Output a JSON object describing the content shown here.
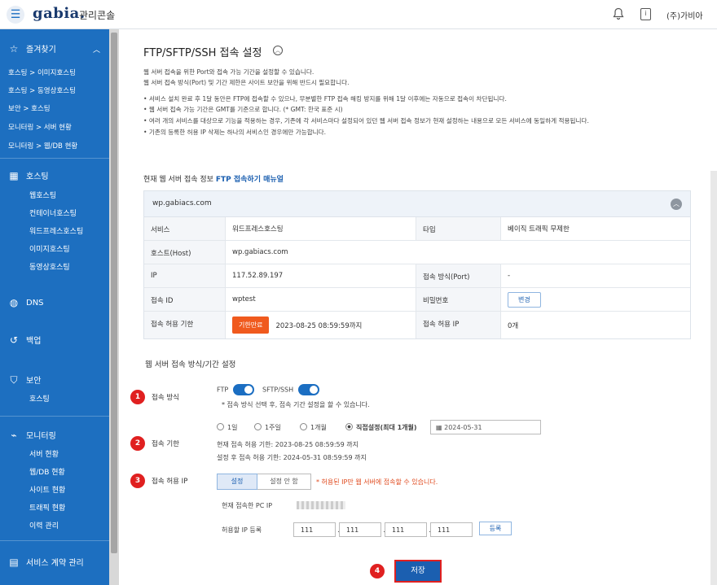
{
  "header": {
    "logo": "gabia.",
    "logo_sub": "관리콘솔",
    "user": "(주)가비아",
    "doc_icon_char": "i"
  },
  "sidebar": {
    "favorites": {
      "label": "즐겨찾기"
    },
    "fav_links": [
      "호스팅 > 이미지호스팅",
      "호스팅 > 동영상호스팅",
      "보안 > 호스팅",
      "모니터링 > 서버 현황",
      "모니터링 > 웹/DB 현황"
    ],
    "hosting": {
      "label": "호스팅",
      "items": [
        "웹호스팅",
        "컨테이너호스팅",
        "워드프레스호스팅",
        "이미지호스팅",
        "동영상호스팅"
      ]
    },
    "dns": {
      "label": "DNS"
    },
    "backup": {
      "label": "백업"
    },
    "security": {
      "label": "보안",
      "items": [
        "호스팅"
      ]
    },
    "monitoring": {
      "label": "모니터링",
      "items": [
        "서버 현황",
        "웹/DB 현황",
        "사이트 현황",
        "트래픽 현황",
        "이력 관리"
      ]
    },
    "contract": {
      "label": "서비스 계약 관리"
    }
  },
  "page": {
    "title": "FTP/SFTP/SSH 접속 설정",
    "desc": [
      "웹 서버 접속을 위한 Port와 접속 가능 기간을 설정할 수 있습니다.",
      "웹 서버 접속 방식(Port) 및 기간 제한은 사이트 보안을 위해 반드시 필요합니다."
    ],
    "bullets": [
      "• 서비스 설치 완료 후 1달 동안은 FTP에 접속할 수 있으나, 무분별한 FTP 접속 해킹 방지를 위해 1달 이후에는 자동으로 접속이 차단됩니다.",
      "• 웹 서버 접속 가능 기간은 GMT를 기준으로 합니다. (* GMT: 한국 표준 시)",
      "• 여러 개의 서비스를 대상으로 기능을 적용하는 경우, 기존에 각 서비스마다 설정되어 있던 웹 서버 접속 정보가 현재 설정하는 내용으로 모든 서비스에 동일하게 적용됩니다.",
      "• 기존의 등록한 허용 IP 삭제는 하나의 서비스인 경우에만 가능합니다."
    ]
  },
  "info": {
    "heading": "현재 웹 서버 접속 정보",
    "manual_link": "FTP 접속하기 매뉴얼",
    "domain": "wp.gabiacs.com",
    "service_label": "서비스",
    "service": "워드프레스호스팅",
    "type_label": "타입",
    "type": "베이직 트래픽 무제한",
    "host_label": "호스트(Host)",
    "host": "wp.gabiacs.com",
    "ip_label": "IP",
    "ip": "117.52.89.197",
    "port_label": "접속 방식(Port)",
    "port": "-",
    "id_label": "접속 ID",
    "id": "wptest",
    "pw_label": "비밀번호",
    "pw_btn": "변경",
    "period_label": "접속 허용 기한",
    "period_btn": "기한만료",
    "period": "2023-08-25 08:59:59까지",
    "allow_ip_label": "접속 허용 IP",
    "allow_ip": "0개"
  },
  "settings": {
    "heading": "웹 서버 접속 방식/기간 설정",
    "method": {
      "num": "1",
      "label": "접속 방식",
      "ftp": "FTP",
      "sftp": "SFTP/SSH",
      "note": "* 접속 방식 선택 후, 접속 기간 설정을 할 수 있습니다."
    },
    "period": {
      "num": "2",
      "label": "접속 기한",
      "options": [
        "1일",
        "1주일",
        "1개월",
        "직접설정(최대 1개월)"
      ],
      "date": "2024-05-31",
      "current": "현재 접속 허용 기한: 2023-08-25 08:59:59 까지",
      "after": "설정 후 접속 허용 기한: 2024-05-31 08:59:59 까지"
    },
    "ip": {
      "num": "3",
      "label": "접속 허용 IP",
      "set": "설정",
      "unset": "설정 안 함",
      "warn": "* 허용된 IP만 웹 서버에 접속할 수 있습니다.",
      "current_pc": "현재 접속한 PC IP",
      "reg_label": "허용할 IP 등록",
      "octets": [
        "111",
        "111",
        "111",
        "111"
      ],
      "reg_btn": "등록"
    },
    "save": {
      "num": "4",
      "label": "저장"
    }
  }
}
